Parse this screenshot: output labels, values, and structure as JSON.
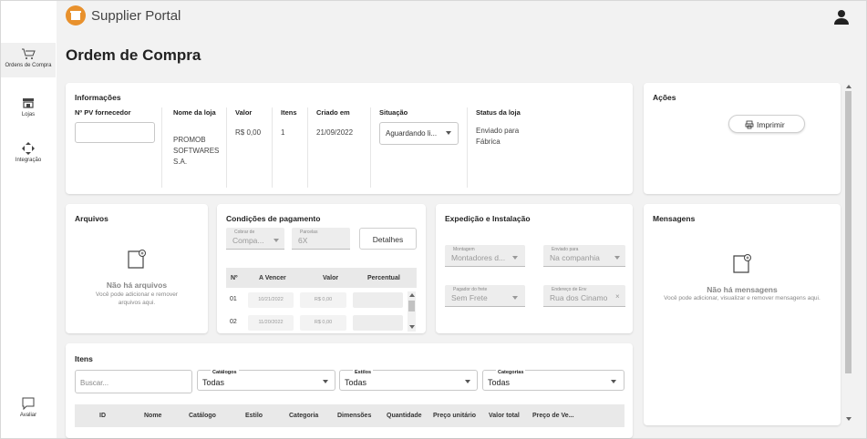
{
  "app": {
    "brand": "Supplier Portal"
  },
  "sidebar": {
    "items": [
      {
        "label": "Ordens de Compra",
        "icon": "cart-icon"
      },
      {
        "label": "Lojas",
        "icon": "store-icon"
      },
      {
        "label": "Integração",
        "icon": "integration-icon"
      },
      {
        "label": "Avaliar",
        "icon": "chat-icon"
      }
    ]
  },
  "page": {
    "title": "Ordem de Compra"
  },
  "info": {
    "title": "Informações",
    "pv_label": "Nº PV fornecedor",
    "pv_value": "",
    "nome_label": "Nome da loja",
    "nome_value": "PROMOB SOFTWARES S.A.",
    "valor_label": "Valor",
    "valor_value": "R$ 0,00",
    "itens_label": "Itens",
    "itens_value": "1",
    "criado_label": "Criado em",
    "criado_value": "21/09/2022",
    "situacao_label": "Situação",
    "situacao_value": "Aguardando li...",
    "status_label": "Status da loja",
    "status_value": "Enviado para Fábrica"
  },
  "acoes": {
    "title": "Ações",
    "print_label": "Imprimir"
  },
  "arquivos": {
    "title": "Arquivos",
    "empty_title": "Não há arquivos",
    "empty_sub": "Você pode adicionar e remover arquivos aqui."
  },
  "pagamento": {
    "title": "Condições de pagamento",
    "cobrar_label": "Cobrar de",
    "cobrar_value": "Compa...",
    "parcelas_label": "Parcelas",
    "parcelas_value": "6X",
    "detalhes_label": "Detalhes",
    "columns": [
      "Nº",
      "A Vencer",
      "Valor",
      "Percentual"
    ],
    "rows": [
      {
        "n": "01",
        "vencer": "10/21/2022",
        "valor": "R$ 0,00",
        "pct": ""
      },
      {
        "n": "02",
        "vencer": "11/20/2022",
        "valor": "R$ 0,00",
        "pct": ""
      }
    ]
  },
  "expedicao": {
    "title": "Expedição e Instalação",
    "montagem_label": "Montagem",
    "montagem_value": "Montadores d...",
    "enviado_label": "Enviado para",
    "enviado_value": "Na companhia",
    "pagador_label": "Pagador do frete",
    "pagador_value": "Sem Frete",
    "endereco_label": "Endereço de Env",
    "endereco_value": "Rua dos Cinamo"
  },
  "mensagens": {
    "title": "Mensagens",
    "empty_title": "Não há mensagens",
    "empty_sub": "Você pode adicionar, visualizar e remover mensagens aqui."
  },
  "itens": {
    "title": "Itens",
    "search_placeholder": "Buscar...",
    "catalogos_label": "Catálogos",
    "catalogos_value": "Todas",
    "estilos_label": "Estilos",
    "estilos_value": "Todas",
    "categorias_label": "Categorias",
    "categorias_value": "Todas",
    "columns": [
      "ID",
      "Nome",
      "Catálogo",
      "Estilo",
      "Categoria",
      "Dimensões",
      "Quantidade",
      "Preço unitário",
      "Valor total",
      "Preço de Ve..."
    ]
  },
  "colors": {
    "accent": "#e8912d",
    "background": "#f2f2f2"
  }
}
